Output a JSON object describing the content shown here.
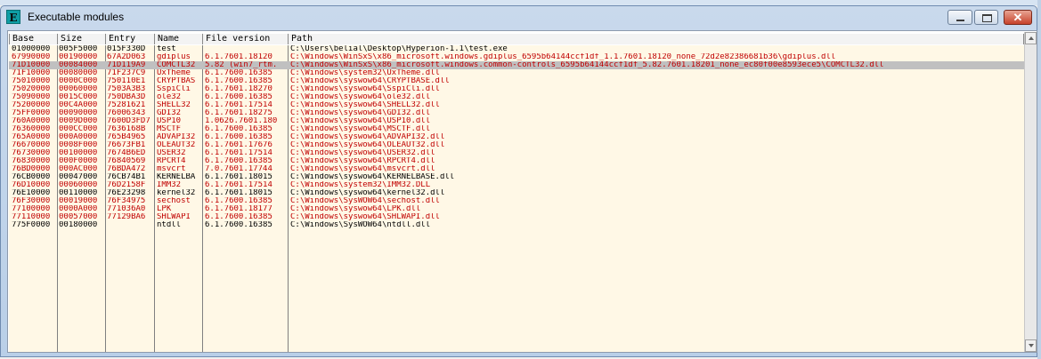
{
  "window": {
    "icon_letter": "E",
    "title": "Executable modules",
    "close_symbol": "✕"
  },
  "colors": {
    "system_text": "#c00000",
    "user_text": "#000000",
    "selected_row": "#c0c0c0",
    "list_background": "#fff8e6"
  },
  "columns": [
    "Base",
    "Size",
    "Entry",
    "Name",
    "File version",
    "Path"
  ],
  "selected_index": 2,
  "rows": [
    {
      "base": "01000000",
      "size": "005F5000",
      "entry": "015F330D",
      "name": "test",
      "version": "",
      "path": "C:\\Users\\belial\\Desktop\\Hyperion-1.1\\test.exe",
      "color": "#000000"
    },
    {
      "base": "67990000",
      "size": "00190000",
      "entry": "67A2D063",
      "name": "gdiplus",
      "version": "6.1.7601.18120",
      "path": "C:\\Windows\\WinSxS\\x86_microsoft.windows.gdiplus_6595b64144ccf1df_1.1.7601.18120_none_72d2e82386681b36\\gdiplus.dll",
      "color": "#c00000"
    },
    {
      "base": "71D10000",
      "size": "00084000",
      "entry": "71D119A9",
      "name": "COMCTL32",
      "version": "5.82 (win7_rtm.",
      "path": "C:\\Windows\\WinSxS\\x86_microsoft.windows.common-controls_6595b64144ccf1df_5.82.7601.18201_none_ec80f00e8593ece5\\COMCTL32.dll",
      "color": "#c00000"
    },
    {
      "base": "71F10000",
      "size": "00080000",
      "entry": "71F237C9",
      "name": "UxTheme",
      "version": "6.1.7600.16385",
      "path": "C:\\Windows\\system32\\UxTheme.dll",
      "color": "#c00000"
    },
    {
      "base": "75010000",
      "size": "0000C000",
      "entry": "750110E1",
      "name": "CRYPTBAS",
      "version": "6.1.7600.16385",
      "path": "C:\\Windows\\syswow64\\CRYPTBASE.dll",
      "color": "#c00000"
    },
    {
      "base": "75020000",
      "size": "00060000",
      "entry": "7503A3B3",
      "name": "SspiCli",
      "version": "6.1.7601.18270",
      "path": "C:\\Windows\\syswow64\\SspiCli.dll",
      "color": "#c00000"
    },
    {
      "base": "75090000",
      "size": "0015C000",
      "entry": "750DBA3D",
      "name": "ole32",
      "version": "6.1.7600.16385",
      "path": "C:\\Windows\\syswow64\\ole32.dll",
      "color": "#c00000"
    },
    {
      "base": "75200000",
      "size": "00C4A000",
      "entry": "75281621",
      "name": "SHELL32",
      "version": "6.1.7601.17514",
      "path": "C:\\Windows\\syswow64\\SHELL32.dll",
      "color": "#c00000"
    },
    {
      "base": "75FF0000",
      "size": "00090000",
      "entry": "76006343",
      "name": "GDI32",
      "version": "6.1.7601.18275",
      "path": "C:\\Windows\\syswow64\\GDI32.dll",
      "color": "#c00000"
    },
    {
      "base": "760A0000",
      "size": "0009D000",
      "entry": "7600D3FD7",
      "name": "USP10",
      "version": "1.0626.7601.180",
      "path": "C:\\Windows\\syswow64\\USP10.dll",
      "color": "#c00000"
    },
    {
      "base": "76360000",
      "size": "000CC000",
      "entry": "7636168B",
      "name": "MSCTF",
      "version": "6.1.7600.16385",
      "path": "C:\\Windows\\syswow64\\MSCTF.dll",
      "color": "#c00000"
    },
    {
      "base": "765A0000",
      "size": "000A0000",
      "entry": "765B4965",
      "name": "ADVAPI32",
      "version": "6.1.7600.16385",
      "path": "C:\\Windows\\syswow64\\ADVAPI32.dll",
      "color": "#c00000"
    },
    {
      "base": "76670000",
      "size": "0008F000",
      "entry": "76673FB1",
      "name": "OLEAUT32",
      "version": "6.1.7601.17676",
      "path": "C:\\Windows\\syswow64\\OLEAUT32.dll",
      "color": "#c00000"
    },
    {
      "base": "76730000",
      "size": "00100000",
      "entry": "7674B6ED",
      "name": "USER32",
      "version": "6.1.7601.17514",
      "path": "C:\\Windows\\syswow64\\USER32.dll",
      "color": "#c00000"
    },
    {
      "base": "76830000",
      "size": "000F0000",
      "entry": "76840569",
      "name": "RPCRT4",
      "version": "6.1.7600.16385",
      "path": "C:\\Windows\\syswow64\\RPCRT4.dll",
      "color": "#c00000"
    },
    {
      "base": "76BD0000",
      "size": "000AC000",
      "entry": "76BDA472",
      "name": "msvcrt",
      "version": "7.0.7601.17744",
      "path": "C:\\Windows\\syswow64\\msvcrt.dll",
      "color": "#c00000"
    },
    {
      "base": "76CB0000",
      "size": "00047000",
      "entry": "76CB74B1",
      "name": "KERNELBA",
      "version": "6.1.7601.18015",
      "path": "C:\\Windows\\syswow64\\KERNELBASE.dll",
      "color": "#000000"
    },
    {
      "base": "76D10000",
      "size": "00060000",
      "entry": "76D2158F",
      "name": "IMM32",
      "version": "6.1.7601.17514",
      "path": "C:\\Windows\\system32\\IMM32.DLL",
      "color": "#c00000"
    },
    {
      "base": "76E10000",
      "size": "00110000",
      "entry": "76E23298",
      "name": "kernel32",
      "version": "6.1.7601.18015",
      "path": "C:\\Windows\\syswow64\\kernel32.dll",
      "color": "#000000"
    },
    {
      "base": "76F30000",
      "size": "00019000",
      "entry": "76F34975",
      "name": "sechost",
      "version": "6.1.7600.16385",
      "path": "C:\\Windows\\SysWOW64\\sechost.dll",
      "color": "#c00000"
    },
    {
      "base": "77100000",
      "size": "0000A000",
      "entry": "771036A0",
      "name": "LPK",
      "version": "6.1.7601.18177",
      "path": "C:\\Windows\\syswow64\\LPK.dll",
      "color": "#c00000"
    },
    {
      "base": "77110000",
      "size": "00057000",
      "entry": "77129BA6",
      "name": "SHLWAPI",
      "version": "6.1.7600.16385",
      "path": "C:\\Windows\\syswow64\\SHLWAPI.dll",
      "color": "#c00000"
    },
    {
      "base": "775F0000",
      "size": "00180000",
      "entry": "",
      "name": "ntdll",
      "version": "6.1.7600.16385",
      "path": "C:\\Windows\\SysWOW64\\ntdll.dll",
      "color": "#000000"
    }
  ]
}
